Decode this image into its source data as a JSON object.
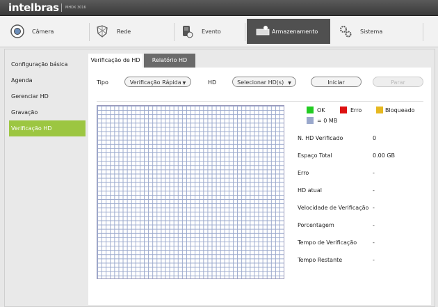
{
  "header": {
    "brand": "intelbras",
    "model": "MHDX 3016"
  },
  "nav": {
    "items": [
      {
        "label": "Câmera"
      },
      {
        "label": "Rede"
      },
      {
        "label": "Evento"
      },
      {
        "label": "Armazenamento"
      },
      {
        "label": "Sistema"
      }
    ]
  },
  "sidebar": {
    "items": [
      {
        "label": "Configuração básica"
      },
      {
        "label": "Agenda"
      },
      {
        "label": "Gerenciar HD"
      },
      {
        "label": "Gravação"
      },
      {
        "label": "Verificação HD"
      }
    ]
  },
  "tabs": [
    {
      "label": "Verificação de HD"
    },
    {
      "label": "Relatório HD"
    }
  ],
  "controls": {
    "tipo_label": "Tipo",
    "tipo_value": "Verificação Rápida",
    "hd_label": "HD",
    "hd_value": "Selecionar HD(s)",
    "start_label": "Iniciar",
    "stop_label": "Parar"
  },
  "legend": {
    "ok": "OK",
    "error": "Erro",
    "blocked": "Bloqueado",
    "unit": "= 0 MB",
    "colors": {
      "ok": "#22cc22",
      "error": "#dd1111",
      "blocked": "#e6b820",
      "unit": "#9aa8cc"
    }
  },
  "info": [
    {
      "label": "N. HD Verificado",
      "value": "0"
    },
    {
      "label": "Espaço Total",
      "value": "0.00 GB"
    },
    {
      "label": "Erro",
      "value": "-"
    },
    {
      "label": "HD atual",
      "value": "-"
    },
    {
      "label": "Velocidade de Verificação",
      "value": "-"
    },
    {
      "label": "Porcentagem",
      "value": "-"
    },
    {
      "label": "Tempo de Verificação",
      "value": "-"
    },
    {
      "label": "Tempo Restante",
      "value": "-"
    }
  ],
  "colors": {
    "accent": "#9cc641"
  }
}
